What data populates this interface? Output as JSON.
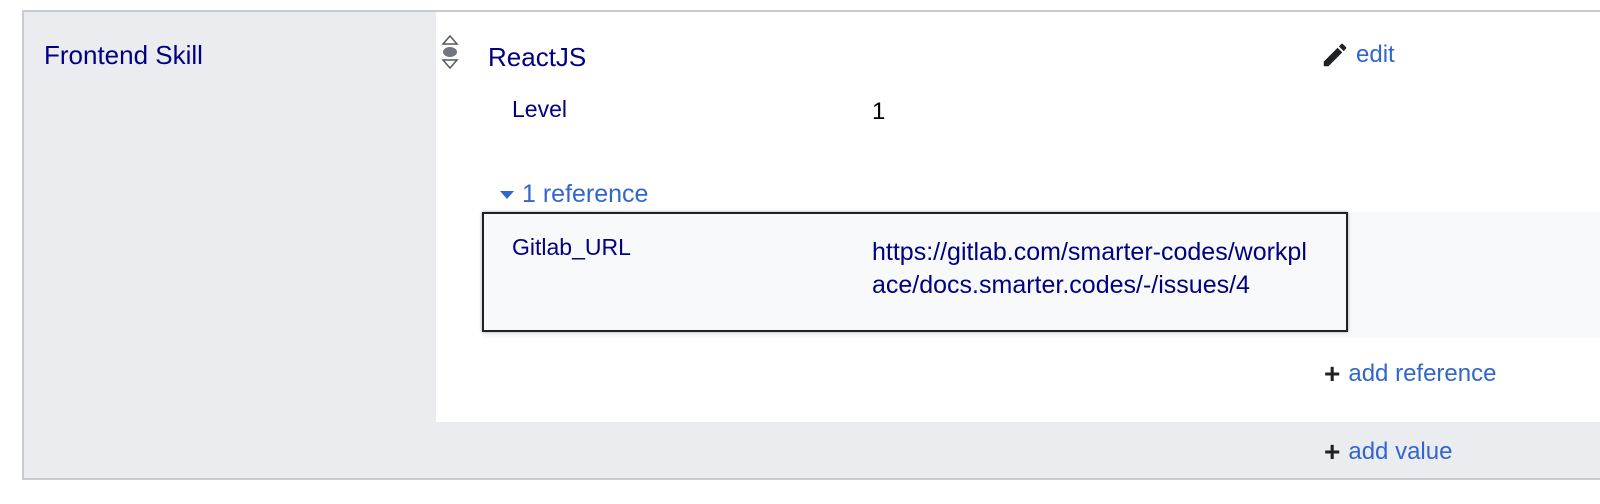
{
  "statement": {
    "property": "Frontend Skill",
    "value": "ReactJS",
    "edit_label": "edit",
    "qualifiers": [
      {
        "property": "Level",
        "value": "1"
      }
    ],
    "references_toggle": "1 reference",
    "references": [
      {
        "property": "Gitlab_URL",
        "value": "https://gitlab.com/smarter-codes/workplace/docs.smarter.codes/-/issues/4"
      }
    ],
    "add_reference_label": "add reference",
    "add_value_label": "add value"
  },
  "icons": {
    "rank": "rank-normal-icon",
    "edit": "pencil-icon",
    "toggle": "triangle-down-icon",
    "add": "plus-icon"
  },
  "colors": {
    "link": "#3366cc",
    "property": "#000080",
    "group_bg": "#eaecf0",
    "border": "#c8ccd1"
  }
}
